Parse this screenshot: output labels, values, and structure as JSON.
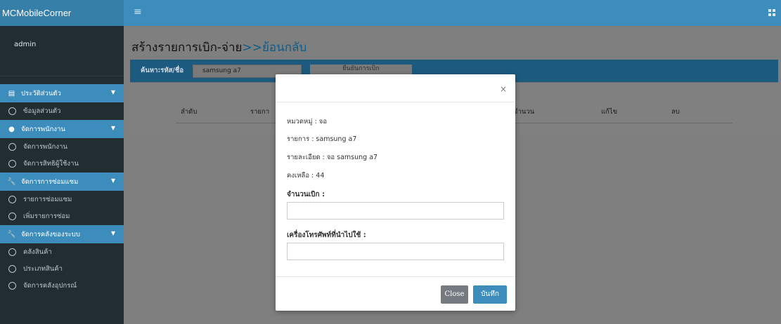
{
  "app": {
    "brand": "MCMobileCorner",
    "user": "admin"
  },
  "colors": {
    "primary": "#3c8dbc",
    "sidebar": "#222d32",
    "overlay": "#7f7f7f"
  },
  "sidebar": {
    "sections": [
      {
        "label": "ประวัติส่วนตัว",
        "icon": "id-card-icon",
        "items": [
          "ข้อมูลส่วนตัว"
        ]
      },
      {
        "label": "จัดการพนักงาน",
        "icon": "users-icon",
        "items": [
          "จัดการพนักงาน",
          "จัดการสิทธิผู้ใช้งาน"
        ]
      },
      {
        "label": "จัดการการซ่อมแซม",
        "icon": "wrench-icon",
        "items": [
          "รายการซ่อมแซม",
          "เพิ่มรายการซ่อม"
        ]
      },
      {
        "label": "จัดการคลังของระบบ",
        "icon": "wrench-icon",
        "items": [
          "คลังสินค้า",
          "ประเภทสินค้า",
          "จัดการคลังอุปกรณ์"
        ]
      }
    ]
  },
  "page": {
    "title": "สร้างรายการเบิก-จ่าย",
    "back_link": ">>ย้อนกลับ",
    "search_label": "ค้นหา:รหัส/ชื่อ",
    "search_value": "samsung a7",
    "search_button": "ยืนยันการเบิก",
    "table_headers": [
      "ลำดับ",
      "รายการ",
      "จำนวน",
      "แก้ไข",
      "ลบ"
    ]
  },
  "modal": {
    "category": "หมวดหมู่ : จอ",
    "item": "รายการ : samsung a7",
    "detail": "รายละเอียด : จอ samsung a7",
    "remaining": "คงเหลือ : 44",
    "qty_label": "จำนวนเบิก :",
    "qty_value": "",
    "phone_label": "เครื่องโทรศัพท์ที่นำไปใช้ :",
    "phone_value": "",
    "close_label": "Close",
    "save_label": "บันทึก",
    "close_icon": "×"
  }
}
